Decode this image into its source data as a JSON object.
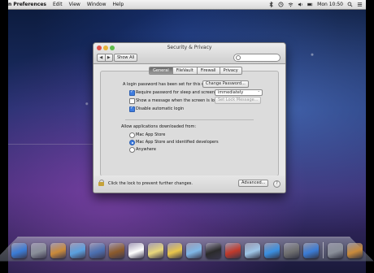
{
  "menubar": {
    "app": "n Preferences",
    "items": [
      "Edit",
      "View",
      "Window",
      "Help"
    ],
    "clock": "Mon 10:50"
  },
  "window": {
    "title": "Security & Privacy",
    "show_all": "Show All",
    "tabs": [
      "General",
      "FileVault",
      "Firewall",
      "Privacy"
    ],
    "active_tab": "General"
  },
  "general": {
    "password_text": "A login password has been set for this user",
    "change_password": "Change Password...",
    "require_password": {
      "label": "Require password for sleep and screen saver",
      "checked": true
    },
    "require_select": "immediately",
    "show_message": {
      "label": "Show a message when the screen is locked",
      "checked": false
    },
    "set_lock_message": "Set Lock Message...",
    "disable_login": {
      "label": "Disable automatic login",
      "checked": true
    },
    "allow_heading": "Allow applications downloaded from:",
    "options": [
      "Mac App Store",
      "Mac App Store and identified developers",
      "Anywhere"
    ],
    "selected_option": 1
  },
  "footer": {
    "lock_text": "Click the lock to prevent further changes.",
    "advanced": "Advanced...",
    "help": "?"
  },
  "dock": {
    "icon_colors": [
      "#3a7bd5",
      "#8a8f99",
      "#c98a3a",
      "#5aa0e0",
      "#4b6fb0",
      "#8b5a2b",
      "#ffffff",
      "#e8d77a",
      "#e9c64a",
      "#7fb8e8",
      "#2a2a2a",
      "#c0392b",
      "#9ec6e8",
      "#3a8fe0",
      "#6f6f6f"
    ]
  }
}
